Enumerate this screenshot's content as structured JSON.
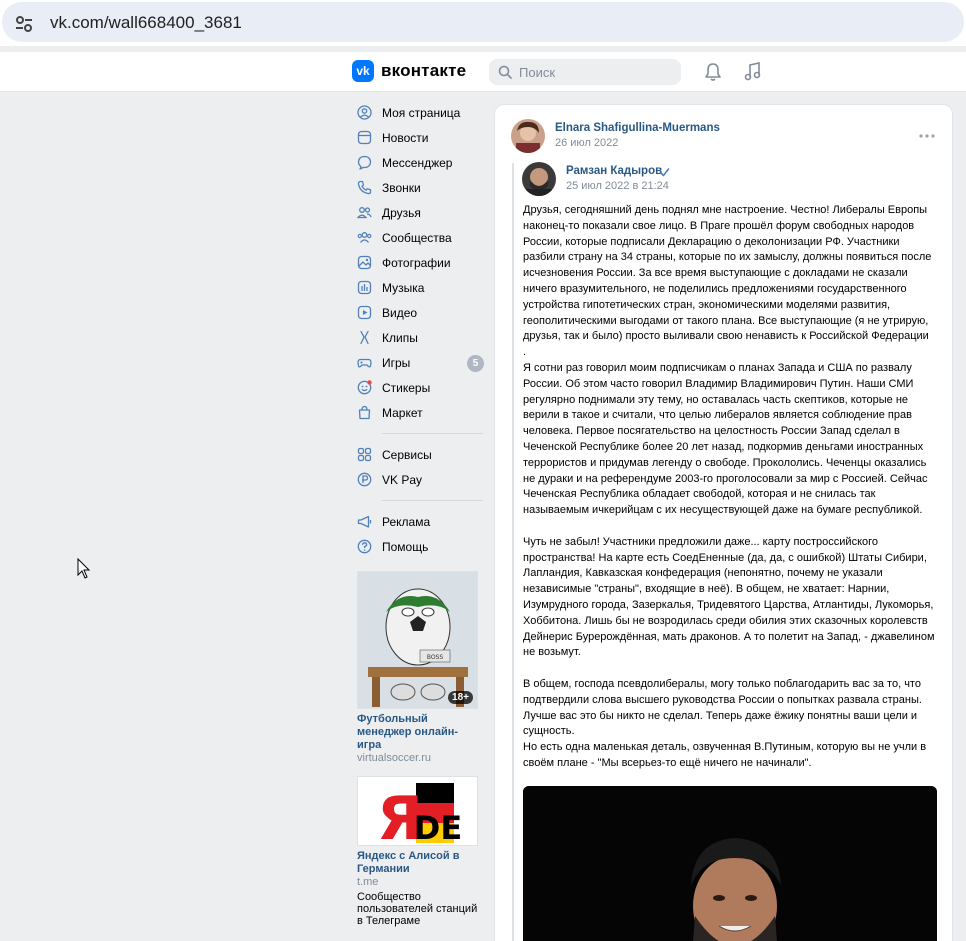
{
  "browser": {
    "url": "vk.com/wall668400_3681"
  },
  "header": {
    "logo_text": "вконтакте",
    "logo_letter": "vk",
    "search_placeholder": "Поиск"
  },
  "nav": {
    "items": [
      {
        "label": "Моя страница",
        "icon": "user-circle-icon"
      },
      {
        "label": "Новости",
        "icon": "news-icon"
      },
      {
        "label": "Мессенджер",
        "icon": "message-icon"
      },
      {
        "label": "Звонки",
        "icon": "phone-icon"
      },
      {
        "label": "Друзья",
        "icon": "friends-icon"
      },
      {
        "label": "Сообщества",
        "icon": "communities-icon"
      },
      {
        "label": "Фотографии",
        "icon": "photo-icon"
      },
      {
        "label": "Музыка",
        "icon": "music-icon"
      },
      {
        "label": "Видео",
        "icon": "video-icon"
      },
      {
        "label": "Клипы",
        "icon": "clips-icon"
      },
      {
        "label": "Игры",
        "icon": "games-icon",
        "badge": "5"
      },
      {
        "label": "Стикеры",
        "icon": "stickers-icon"
      },
      {
        "label": "Маркет",
        "icon": "market-icon"
      }
    ],
    "services": [
      {
        "label": "Сервисы",
        "icon": "services-icon"
      },
      {
        "label": "VK Pay",
        "icon": "vkpay-icon"
      }
    ],
    "footer": [
      {
        "label": "Реклама",
        "icon": "ads-icon"
      },
      {
        "label": "Помощь",
        "icon": "help-icon"
      }
    ]
  },
  "ads": [
    {
      "title": "Футбольный менеджер онлайн-игра",
      "domain": "virtualsoccer.ru",
      "badge": "18+",
      "image_text": "BOSS"
    },
    {
      "title": "Яндекс с Алисой в Германии",
      "domain": "t.me",
      "description": "Сообщество пользователей станций в Телеграме",
      "image_text_1": "Я",
      "image_text_2": "DE"
    }
  ],
  "post": {
    "author": "Elnara Shafigullina-Muermans",
    "date": "26 июл 2022",
    "repost": {
      "author": "Рамзан Кадыров",
      "date": "25 июл 2022 в 21:24",
      "text": "Друзья, сегодняшний день поднял мне настроение. Честно! Либералы Европы наконец-то показали свое лицо. В Праге прошёл форум свободных народов России, которые подписали Декларацию о деколонизации РФ. Участники разбили страну на 34 страны, которые по их замыслу, должны появиться после исчезновения России. За все время выступающие с докладами не сказали ничего вразумительного, не поделились предложениями государственного устройства гипотетических стран, экономическими моделями развития, геополитическими выгодами от такого плана. Все выступающие (я не утрирую, друзья, так и было) просто выливали свою ненависть к Российской Федерации\n.\nЯ сотни раз говорил моим подписчикам о планах Запада и США по развалу России. Об этом часто говорил Владимир Владимирович Путин. Наши СМИ регулярно поднимали эту тему, но оставалась часть скептиков, которые не верили в такое и считали, что целью либералов является соблюдение прав человека. Первое посягательство на целостность России Запад сделал в Чеченской Республике более 20 лет назад, подкормив деньгами иностранных террористов и придумав легенду о свободе. Прокололись. Чеченцы оказались не дураки и на референдуме 2003-го проголосовали за мир с Россией. Сейчас Чеченская Республика обладает свободой, которая и не снилась так называемым ичкерийцам с их несуществующей даже на бумаге республикой.\n\nЧуть не забыл! Участники предложили даже... карту построссийского пространства! На карте есть СоедЕненные (да, да, с ошибкой) Штаты Сибири, Лапландия, Кавказская конфедерация (непонятно, почему не указали независимые \"страны\", входящие в неё). В общем, не хватает: Нарнии, Изумрудного города, Зазеркалья, Тридевятого Царства, Атлантиды, Лукоморья, Хоббитона. Лишь бы не возродилась среди обилия этих сказочных королевств Дейнерис Бурерождённая, мать драконов. А то полетит на Запад, - джавелином не возьмут.\n\nВ общем, господа псевдолибералы, могу только поблагодарить вас за то, что подтвердили слова высшего руководства России о попытках развала страны. Лучше вас это бы никто не сделал. Теперь даже ёжику понятны ваши цели и сущность.\nНо есть одна маленькая деталь, озвученная В.Путиным, которую вы не учли в своём плане - \"Мы всерьез-то ещё ничего не начинали\"."
    }
  },
  "colors": {
    "accent": "#0077ff",
    "link": "#2a5885",
    "background": "#edeef0",
    "secondary_text": "#818c99"
  }
}
